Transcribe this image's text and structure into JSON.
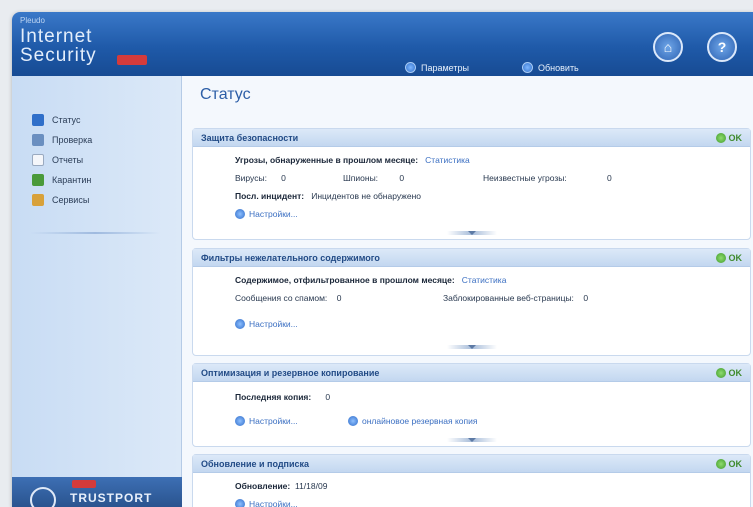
{
  "app": {
    "brand_small": "Pleudo",
    "brand_line1": "Internet",
    "brand_line2": "Security"
  },
  "toolbar": {
    "settings_label": "Параметры",
    "update_label": "Обновить",
    "home_icon": "home-icon",
    "help_icon": "help-icon"
  },
  "sidebar": {
    "items": [
      {
        "label": "Статус",
        "icon": "status-icon"
      },
      {
        "label": "Проверка",
        "icon": "scan-icon"
      },
      {
        "label": "Отчеты",
        "icon": "reports-icon"
      },
      {
        "label": "Карантин",
        "icon": "quarantine-icon"
      },
      {
        "label": "Сервисы",
        "icon": "services-icon"
      }
    ],
    "footer_logo": "TRUSTPORT"
  },
  "main": {
    "title": "Статус",
    "panels": [
      {
        "title": "Защита безопасности",
        "status": "OK",
        "line1_label": "Угрозы, обнаруженные в прошлом месяце:",
        "line1_link": "Статистика",
        "viruses_label": "Вирусы:",
        "viruses_value": "0",
        "spyware_label": "Шпионы:",
        "spyware_value": "0",
        "unknown_label": "Неизвестные угрозы:",
        "unknown_value": "0",
        "incident_label": "Посл. инцидент:",
        "incident_value": "Инцидентов не обнаружено",
        "settings_link": "Настройки..."
      },
      {
        "title": "Фильтры нежелательного содержимого",
        "status": "OK",
        "line1_label": "Содержимое, отфильтрованное в прошлом месяце:",
        "line1_link": "Статистика",
        "spam_label": "Сообщения со спамом:",
        "spam_value": "0",
        "blocked_label": "Заблокированные веб-страницы:",
        "blocked_value": "0",
        "settings_link": "Настройки..."
      },
      {
        "title": "Оптимизация и резервное копирование",
        "status": "OK",
        "backup_label": "Последняя копия:",
        "backup_value": "0",
        "settings_link": "Настройки...",
        "online_backup_link": "онлайновое резервная копия"
      },
      {
        "title": "Обновление и подписка",
        "status": "OK",
        "update_label": "Обновление:",
        "update_value": "11/18/09",
        "settings_link": "Настройки..."
      }
    ]
  },
  "colors": {
    "title_bar": "#1f5aa9",
    "accent": "#2c5ea7",
    "ok_green": "#3e8a2c"
  }
}
